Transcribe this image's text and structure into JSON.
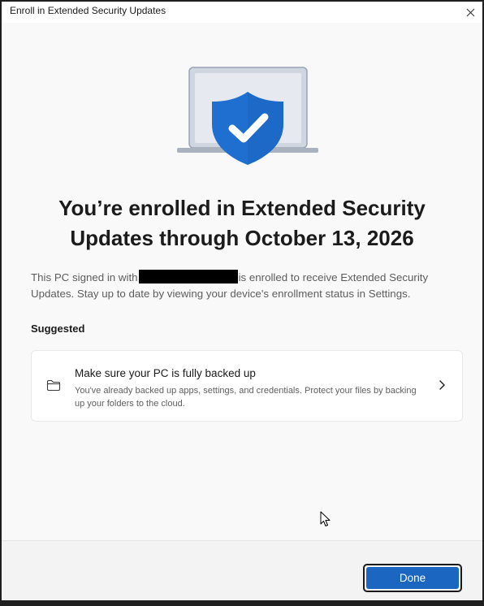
{
  "window": {
    "title": "Enroll in Extended Security Updates"
  },
  "heading": {
    "line1": "You’re enrolled in Extended Security",
    "line2": "Updates through October 13, 2026"
  },
  "body": {
    "before_redaction": "This PC signed in with",
    "after_redaction": "is enrolled to receive Extended Security Updates. Stay up to date by viewing your device's enrollment status in Settings."
  },
  "suggested": {
    "label": "Suggested",
    "card": {
      "icon": "folder-icon",
      "title": "Make sure your PC is fully backed up",
      "description": "You've already backed up apps, settings, and credentials. Protect your files by backing up your folders to the cloud."
    }
  },
  "footer": {
    "done_label": "Done"
  },
  "colors": {
    "accent": "#1a66c0",
    "shield": "#1f6fd1"
  }
}
